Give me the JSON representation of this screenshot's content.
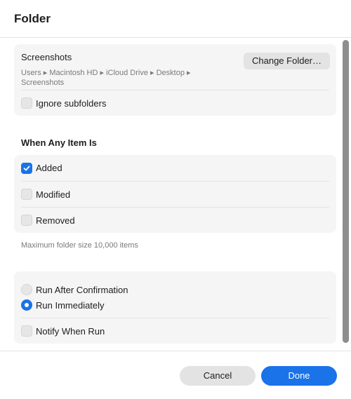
{
  "header": {
    "title": "Folder"
  },
  "folder": {
    "name": "Screenshots",
    "path": "Users ▸ Macintosh HD ▸ iCloud Drive ▸ Desktop ▸ Screenshots",
    "change_button": "Change Folder…",
    "ignore_subfolders": {
      "label": "Ignore subfolders",
      "checked": false
    }
  },
  "when_section": {
    "heading": "When Any Item Is",
    "options": [
      {
        "label": "Added",
        "checked": true
      },
      {
        "label": "Modified",
        "checked": false
      },
      {
        "label": "Removed",
        "checked": false
      }
    ],
    "footnote": "Maximum folder size 10,000 items"
  },
  "run_section": {
    "radios": [
      {
        "label": "Run After Confirmation",
        "selected": false
      },
      {
        "label": "Run Immediately",
        "selected": true
      }
    ],
    "notify": {
      "label": "Notify When Run",
      "checked": false
    }
  },
  "footer": {
    "cancel_label": "Cancel",
    "done_label": "Done"
  },
  "colors": {
    "accent": "#1a73e8",
    "group_bg": "#f5f5f5",
    "secondary_text": "#7a7a7a"
  }
}
